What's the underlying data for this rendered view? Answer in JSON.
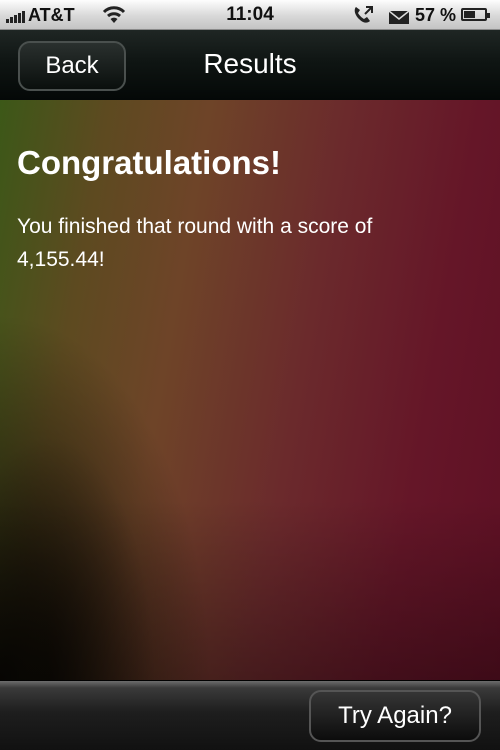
{
  "status_bar": {
    "carrier": "AT&T",
    "time": "11:04",
    "battery_percent": "57 %",
    "battery_level": 0.57,
    "icons": [
      "signal-icon",
      "wifi-icon",
      "call-forward-icon",
      "mail-icon",
      "battery-icon"
    ]
  },
  "nav_bar": {
    "back_label": "Back",
    "title": "Results"
  },
  "content": {
    "heading": "Congratulations!",
    "message": "You finished that round with a score of 4,155.44!"
  },
  "toolbar": {
    "try_again_label": "Try Again?"
  },
  "colors": {
    "gradient_green": "#3c5818",
    "gradient_brown": "#6e4428",
    "gradient_maroon": "#651628",
    "nav_bar": "#0f1513"
  }
}
